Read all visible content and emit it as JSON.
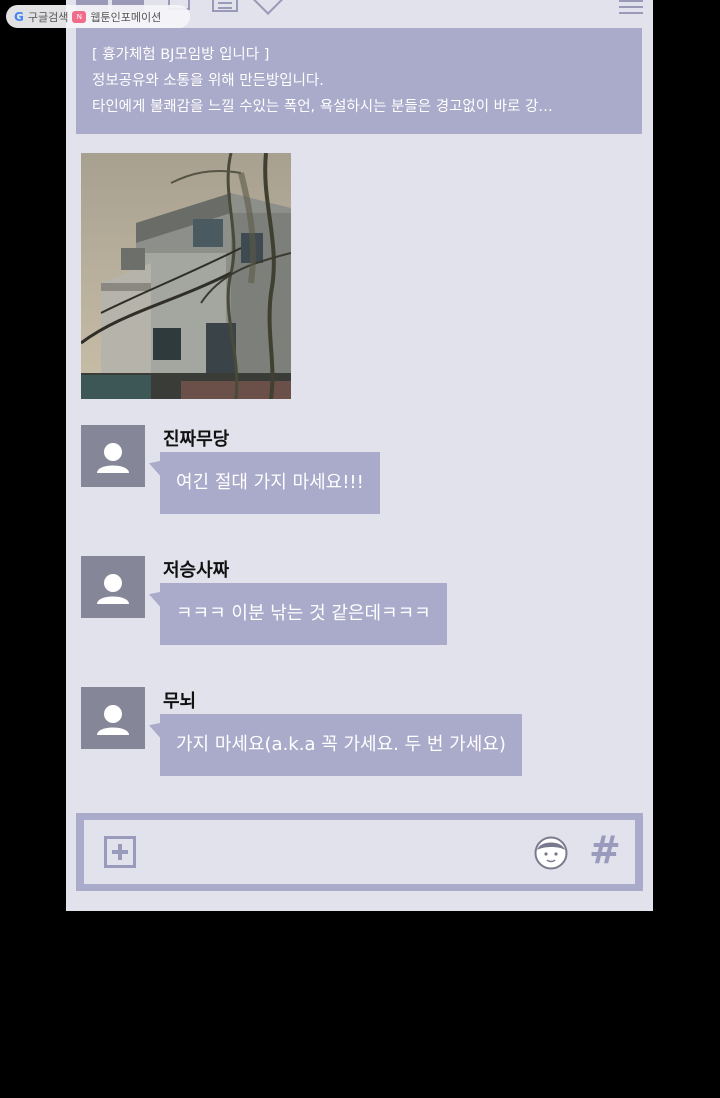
{
  "watermark": {
    "search_label": "구글검색",
    "brand_label": "웹툰인포메이션"
  },
  "notice": {
    "lines": [
      "[ 흉가체험 BJ모임방 입니다 ]",
      "정보공유와 소통을 위해 만든방입니다.",
      "타인에게 불쾌감을 느낄 수있는 폭언, 욕설하시는 분들은 경고없이 바로 강…"
    ]
  },
  "messages": [
    {
      "sender": "진짜무당",
      "text": "여긴 절대 가지 마세요!!!"
    },
    {
      "sender": "저승사짜",
      "text": "ㅋㅋㅋ 이분 낚는 것 같은데ㅋㅋㅋ"
    },
    {
      "sender": "무뇌",
      "text": "가지 마세요(a.k.a 꼭 가세요. 두 번 가세요)"
    }
  ],
  "input_bar": {
    "hash_symbol": "#"
  },
  "colors": {
    "background": "#000000",
    "chat_bg": "#e2e2ec",
    "bubble": "#aaaaca",
    "avatar": "#868699",
    "icon": "#9a9abc"
  },
  "icons": [
    "search-badge-icon",
    "menu-icon",
    "plus-icon",
    "emoji-icon",
    "hashtag-icon",
    "user-icon"
  ]
}
